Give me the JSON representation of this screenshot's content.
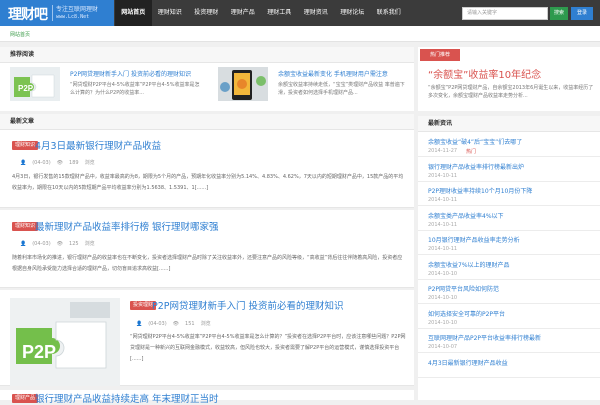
{
  "logo": {
    "main": "理财吧",
    "slogan": "专注互联网理财",
    "domain": "www.Lc8.Net"
  },
  "nav": {
    "items": [
      "网站首页",
      "理财知识",
      "投资理财",
      "理财产品",
      "理财工具",
      "理财资讯",
      "理财论坛",
      "联系我们"
    ]
  },
  "search": {
    "placeholder": "请输入关键字",
    "button": "搜索",
    "login": "登录"
  },
  "breadcrumb": "网站首页",
  "featured": {
    "title": "推荐阅读",
    "items": [
      {
        "title": "P2P网贷理财新手入门 投资前必看的理财知识",
        "desc": "“网贷理财P2P平台4-5%收益率”P2P平台4-5%收益率是怎么计算的？为什么P2P的收益率..."
      },
      {
        "title": "余额宝收益最新变化 手机理财用户需注意",
        "desc": "余额宝收益率持续走低，“宝宝”类理财产品收益 率普遍下滑，投资者如何选择手机理财产品..."
      }
    ]
  },
  "latest": {
    "title": "最新文章"
  },
  "articles": [
    {
      "tag": "理财知识",
      "title": "4月3日最新银行理财产品收益",
      "date": "(04-03)",
      "views": "189",
      "views_unit": "浏览",
      "excerpt": "4月3日，银行发售的15款理财产品中，收益率最高的为8，期限为5个月的产品，预期年化收益率分别为5.14%、4.83%、4.62%，7天以内的短期理财产品中，15款产品的平均收益率为，期限在10天以内的5款短期产品平均收益率分别为1.5638、1.5391、1[......]"
    },
    {
      "tag": "理财知识",
      "title": "最新理财产品收益率排行榜 银行理财哪家强",
      "date": "(04-03)",
      "views": "125",
      "views_unit": "浏览",
      "excerpt": "随着利率市场化的推进，银行理财产品的收益率也在不断变化，投资者选择理财产品时除了关注收益率外，还要注意产品的风险等级，“高收益”背后往往伴随着高风险，投资者应根据自身风险承受能力选择合适的理财产品，切勿盲目追求高收益[......]"
    },
    {
      "tag": "投资理财",
      "title": "P2P网贷理财新手入门 投资前必看的理财知识",
      "date": "(04-03)",
      "views": "151",
      "views_unit": "浏览",
      "excerpt": "“网贷理财P2P平台4-5%收益率”P2P平台4-5%收益率是怎么计算的？”投资者在选择P2P平台时，应该注意哪些问题？P2P网贷理财是一种新兴的互联网金融模式，收益较高，但风险也较大，投资者需要了解P2P平台的运营模式，谨慎选择投资平台[......]"
    },
    {
      "tag": "理财产品",
      "title": "银行理财产品收益持续走高 年末理财正当时",
      "date": "",
      "views": "",
      "views_unit": "",
      "excerpt": ""
    }
  ],
  "sidebar": {
    "hot_tag": "热门推荐",
    "hot_title": "“余额宝”收益率10年纪念",
    "hot_desc": "“余额宝”P2P网贷理财产品，自余额宝2013年6月诞生以来，收益率经历了多次变化，余额宝理财产品收益率走势分析...",
    "list_title": "最新资讯",
    "list": [
      {
        "title": "余额宝收益“破4”后“宝宝”们去哪了",
        "date": "2014-11-27",
        "badge": "热门"
      },
      {
        "title": "银行理财产品收益率排行榜最新出炉",
        "date": "2014-10-11"
      },
      {
        "title": "P2P理财收益率持续10个月10月份下降",
        "date": "2014-10-11"
      },
      {
        "title": "余额宝类产品收益率4%以下",
        "date": "2014-10-11"
      },
      {
        "title": "10月银行理财产品收益率走势分析",
        "date": "2014-10-11"
      },
      {
        "title": "余额宝收益7%以上的理财产品",
        "date": "2014-10-10"
      },
      {
        "title": "P2P网贷平台风险如何防范",
        "date": "2014-10-10"
      },
      {
        "title": "如何选择安全可靠的P2P平台",
        "date": "2014-10-10"
      },
      {
        "title": "互联网理财产品P2P平台收益率排行榜最新",
        "date": "2014-10-07"
      },
      {
        "title": "4月3日最新银行理财产品收益",
        "date": ""
      }
    ]
  }
}
